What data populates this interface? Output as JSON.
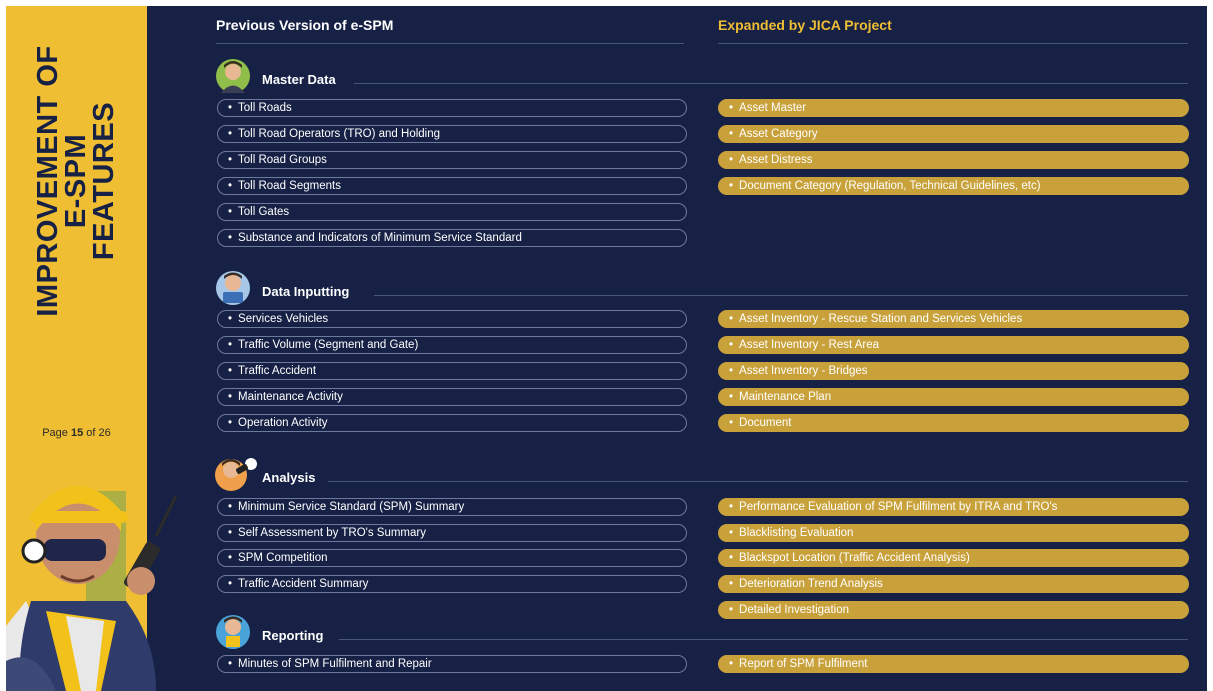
{
  "sidebar": {
    "title_lines": [
      "IMPROVEMENT OF",
      "E-SPM",
      "FEATURES"
    ],
    "page": {
      "prefix": "Page ",
      "current": "15",
      "middle": " of ",
      "total": "26"
    }
  },
  "columns": {
    "left": "Previous Version of e-SPM",
    "right": "Expanded by JICA Project"
  },
  "sections": {
    "master": {
      "title": "Master Data",
      "left": [
        "Toll Roads",
        "Toll Road Operators (TRO) and Holding",
        "Toll Road Groups",
        "Toll Road Segments",
        "Toll Gates",
        "Substance and Indicators of Minimum Service Standard"
      ],
      "right": [
        "Asset Master",
        "Asset Category",
        "Asset Distress",
        "Document Category (Regulation, Technical Guidelines, etc)"
      ]
    },
    "input": {
      "title": "Data Inputting",
      "left": [
        "Services Vehicles",
        "Traffic Volume (Segment and Gate)",
        "Traffic Accident",
        "Maintenance Activity",
        "Operation Activity"
      ],
      "right": [
        "Asset Inventory - Rescue Station and Services Vehicles",
        "Asset Inventory - Rest Area",
        "Asset Inventory - Bridges",
        "Maintenance Plan",
        "Document"
      ]
    },
    "analysis": {
      "title": "Analysis",
      "left": [
        "Minimum Service Standard (SPM) Summary",
        "Self Assessment by TRO's Summary",
        "SPM Competition",
        "Traffic Accident Summary"
      ],
      "right": [
        "Performance Evaluation of SPM Fulfilment by ITRA and TRO's",
        "Blacklisting Evaluation",
        "Blackspot Location (Traffic Accident Analysis)",
        "Deterioration Trend Analysis",
        "Detailed Investigation"
      ]
    },
    "reporting": {
      "title": "Reporting",
      "left": [
        "Minutes of SPM Fulfilment and Repair"
      ],
      "right": [
        "Report of SPM Fulfilment"
      ]
    }
  }
}
